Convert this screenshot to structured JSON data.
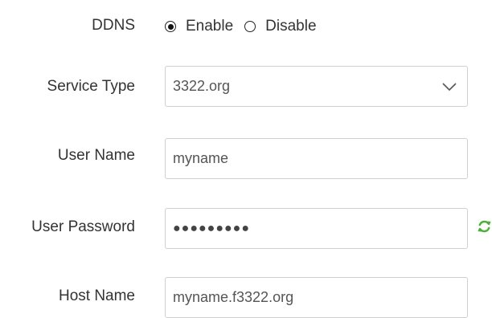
{
  "ddns": {
    "label": "DDNS",
    "options": [
      {
        "label": "Enable",
        "selected": true
      },
      {
        "label": "Disable",
        "selected": false
      }
    ]
  },
  "service_type": {
    "label": "Service Type",
    "value": "3322.org"
  },
  "user_name": {
    "label": "User Name",
    "value": "myname"
  },
  "user_password": {
    "label": "User Password",
    "value": "●●●●●●●●●"
  },
  "host_name": {
    "label": "Host Name",
    "value": "myname.f3322.org"
  },
  "icons": {
    "password_action": "refresh-icon",
    "select_arrow": "chevron-down-icon"
  },
  "colors": {
    "refresh_icon": "#4caf3a",
    "field_border": "#cfcfcf",
    "text": "#333333"
  }
}
